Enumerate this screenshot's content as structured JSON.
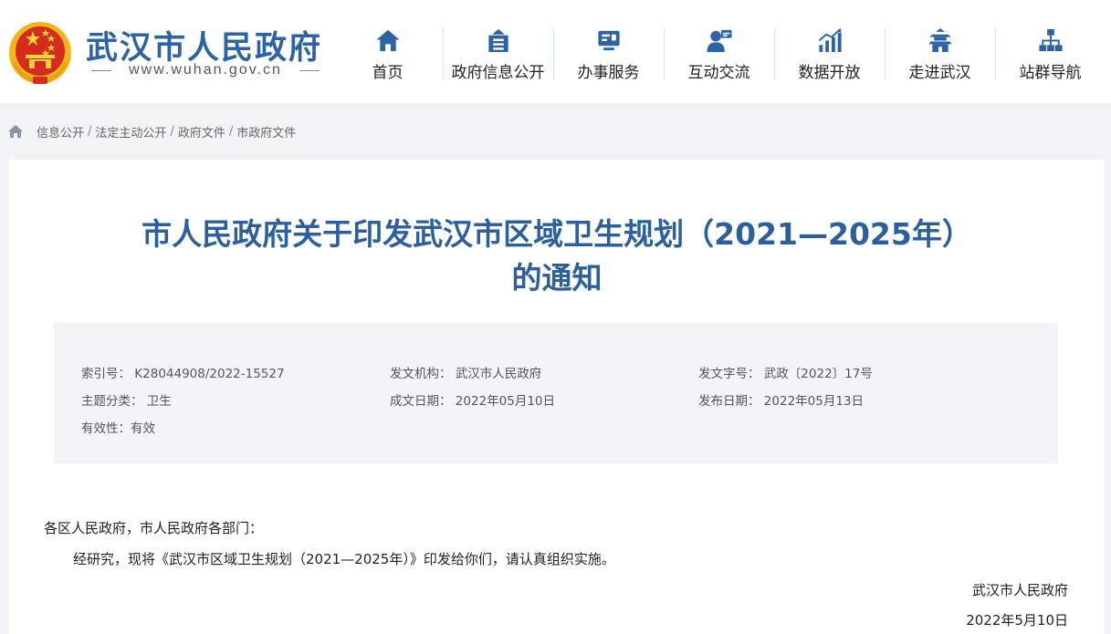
{
  "header": {
    "site_title": "武汉市人民政府",
    "site_url": "www.wuhan.gov.cn",
    "brand_color": "#2b63a6",
    "nav": [
      {
        "label": "首页",
        "icon": "home-icon"
      },
      {
        "label": "政府信息公开",
        "icon": "info-disclosure-icon"
      },
      {
        "label": "办事服务",
        "icon": "service-icon"
      },
      {
        "label": "互动交流",
        "icon": "interaction-icon"
      },
      {
        "label": "数据开放",
        "icon": "data-chart-icon"
      },
      {
        "label": "走进武汉",
        "icon": "landmark-icon"
      },
      {
        "label": "站群导航",
        "icon": "sitemap-icon"
      }
    ]
  },
  "breadcrumb": [
    "信息公开",
    "法定主动公开",
    "政府文件",
    "市政府文件"
  ],
  "document": {
    "title_line1": "市人民政府关于印发武汉市区域卫生规划（2021—2025年）",
    "title_line2": "的通知",
    "title_color": "#2b5f9e",
    "meta": {
      "index_label": "索引号：",
      "index_value": "K28044908/2022-15527",
      "issuer_label": "发文机构：",
      "issuer_value": "武汉市人民政府",
      "doc_no_label": "发文字号：",
      "doc_no_value": "武政〔2022〕17号",
      "topic_label": "主题分类：",
      "topic_value": "卫生",
      "created_label": "成文日期：",
      "created_value": "2022年05月10日",
      "published_label": "发布日期：",
      "published_value": "2022年05月13日",
      "validity_label": "有效性：",
      "validity_value": "有效"
    },
    "salutation": "各区人民政府，市人民政府各部门：",
    "paragraph": "经研究，现将《武汉市区域卫生规划（2021—2025年）》印发给你们，请认真组织实施。",
    "signature": "武汉市人民政府",
    "signature_date": "2022年5月10日"
  }
}
